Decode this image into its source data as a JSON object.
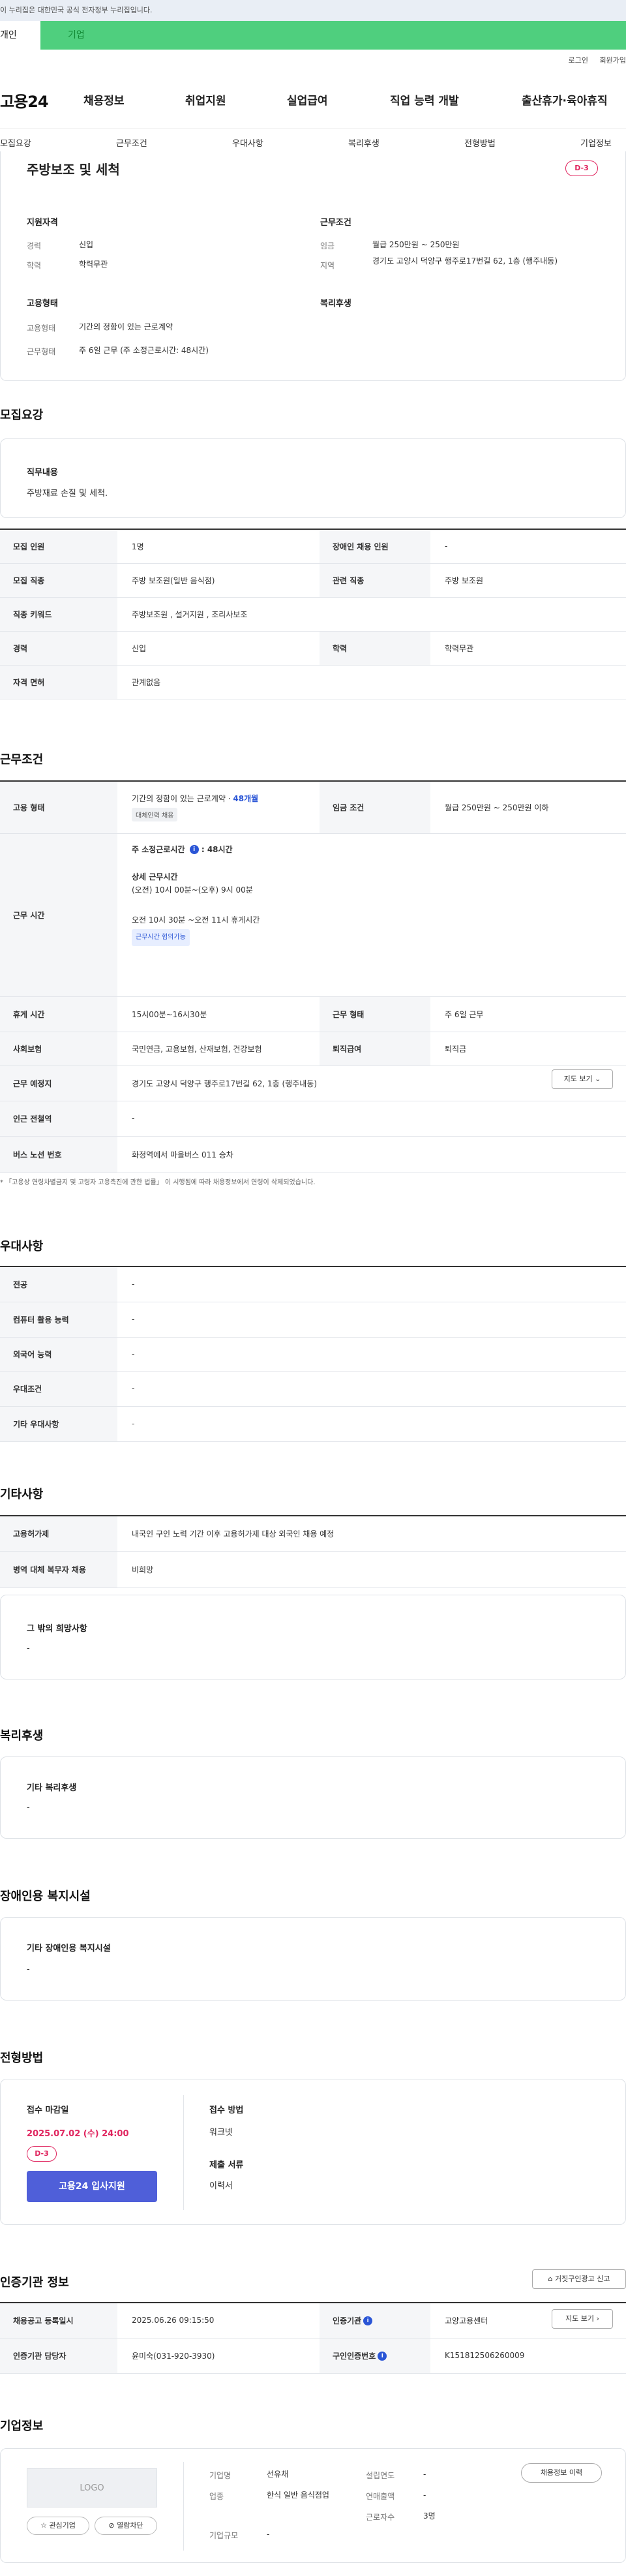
{
  "gov_banner": "이 누리집은 대한민국 공식 전자정부 누리집입니다.",
  "type_tabs": [
    "개인",
    "기업"
  ],
  "util_links": [
    "로그인",
    "회원가입"
  ],
  "logo": "고용24",
  "gnb": [
    "채용정보",
    "취업지원",
    "실업급여",
    "직업 능력 개발",
    "출산휴가·육아휴직"
  ],
  "subnav": [
    "모집요강",
    "근무조건",
    "우대사항",
    "복리후생",
    "전형방법",
    "기업정보"
  ],
  "summary": {
    "title": "주방보조 및 세척",
    "dday": "D-3",
    "qual_head": "지원자격",
    "career_k": "경력",
    "career_v": "신입",
    "edu_k": "학력",
    "edu_v": "학력무관",
    "cond_head": "근무조건",
    "wage_k": "임금",
    "wage_v": "월급 250만원 ~ 250만원",
    "region_k": "지역",
    "region_v": "경기도 고양시 덕양구 행주로17번길 62, 1층 (행주내동)",
    "emp_head": "고용형태",
    "emptype_k": "고용형태",
    "emptype_v": "기간의 정함이 있는 근로계약",
    "worktype_k": "근무형태",
    "worktype_v": "주 6일 근무 (주 소정근로시간: 48시간)",
    "welfare_head": "복리후생"
  },
  "recruit": {
    "title": "모집요강",
    "duty_head": "직무내용",
    "duty_text": "주방재료 손질 및 세척.",
    "rows": {
      "headcount_k": "모집 인원",
      "headcount_v": "1명",
      "disabled_k": "장애인 채용 인원",
      "disabled_v": "-",
      "job_k": "모집 직종",
      "job_v": "주방 보조원(일반 음식점)",
      "related_k": "관련 직종",
      "related_v": "주방 보조원",
      "keyword_k": "직종 키워드",
      "keyword_v": "주방보조원 , 설거지원 , 조리사보조",
      "career_k": "경력",
      "career_v": "신입",
      "edu_k": "학력",
      "edu_v": "학력무관",
      "license_k": "자격 면허",
      "license_v": "관계없음"
    }
  },
  "work": {
    "title": "근무조건",
    "emptype_k": "고용 형태",
    "emptype_v": "기간의 정함이 있는 근로계약 · ",
    "emptype_link": "48개월",
    "emptype_tag": "대체인력 채용",
    "wage_k": "임금 조건",
    "wage_v": "월급 250만원 ~ 250만원 이하",
    "hours_k": "근무 시간",
    "hours_week": "주 소정근로시간",
    "hours_week_v": "48시간",
    "hours_detail_head": "상세 근무시간",
    "hours_detail_1": "(오전) 10시 00분~(오후) 9시 00분",
    "hours_detail_2": "오전 10시 30분 ~오전 11시 휴게시간",
    "hours_tag": "근무시간 협의가능",
    "rest_k": "휴게 시간",
    "rest_v": "15시00분~16시30분",
    "worktype_k": "근무 형태",
    "worktype_v": "주 6일 근무",
    "insurance_k": "사회보험",
    "insurance_v": "국민연금, 고용보험, 산재보험, 건강보험",
    "retire_k": "퇴직급여",
    "retire_v": "퇴직금",
    "place_k": "근무 예정지",
    "place_v": "경기도 고양시 덕양구 행주로17번길 62, 1층 (행주내동)",
    "map_btn": "지도 보기",
    "station_k": "인근 전철역",
    "station_v": "-",
    "bus_k": "버스 노선 번호",
    "bus_v": "화정역에서 마을버스 011 승차",
    "footnote": "* 「고용상 연령차별금지 및 고령자 고용촉진에 관한 법률」 이 시행됨에 따라 채용정보에서 연령이 삭제되었습니다."
  },
  "pref": {
    "title": "우대사항",
    "rows": [
      {
        "k": "전공",
        "v": "-"
      },
      {
        "k": "컴퓨터 활용 능력",
        "v": "-"
      },
      {
        "k": "외국어 능력",
        "v": "-"
      },
      {
        "k": "우대조건",
        "v": "-"
      },
      {
        "k": "기타 우대사항",
        "v": "-"
      }
    ]
  },
  "etc": {
    "title": "기타사항",
    "foreign_k": "고용허가제",
    "foreign_v": "내국인 구인 노력 기간 이후 고용허가제 대상 외국인 채용 예정",
    "military_k": "병역 대체 복무자 채용",
    "military_v": "비희망",
    "other_head": "그 밖의 희망사항",
    "other_v": "-"
  },
  "welfare": {
    "title": "복리후생",
    "head": "기타 복리후생",
    "v": "-"
  },
  "disabled": {
    "title": "장애인용 복지시설",
    "head": "기타 장애인용 복지시설",
    "v": "-"
  },
  "apply": {
    "title": "전형방법",
    "deadline_head": "접수 마감일",
    "deadline_v": "2025.07.02 (수) 24:00",
    "dday": "D-3",
    "apply_btn": "고용24 입사지원",
    "method_head": "접수 방법",
    "method_v": "워크넷",
    "doc_head": "제출 서류",
    "doc_v": "이력서"
  },
  "agency": {
    "title": "인증기관 정보",
    "report_btn": "거짓구인광고 신고",
    "reg_k": "채용공고 등록일시",
    "reg_v": "2025.06.26 09:15:50",
    "org_k": "인증기관",
    "org_v": "고양고용센터",
    "map_btn": "지도 보기",
    "manager_k": "인증기관 담당자",
    "manager_v": "윤미숙(031-920-3930)",
    "cert_k": "구인인증번호",
    "cert_v": "K151812506260009"
  },
  "company": {
    "title": "기업정보",
    "logo": "LOGO",
    "fav_btn": "관심기업",
    "block_btn": "열람차단",
    "name_k": "기업명",
    "name_v": "선유채",
    "industry_k": "업종",
    "industry_v": "한식 일반 음식점업",
    "scale_k": "기업규모",
    "scale_v": "-",
    "founded_k": "설립연도",
    "founded_v": "-",
    "sales_k": "연매출액",
    "sales_v": "-",
    "staff_k": "근로자수",
    "staff_v": "3명",
    "history_btn": "채용정보 이력"
  }
}
